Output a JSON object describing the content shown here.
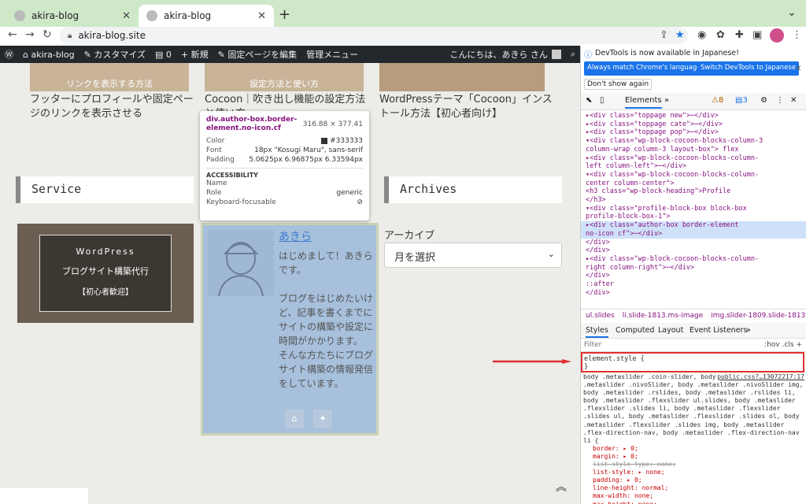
{
  "browser": {
    "tabs": [
      {
        "title": "akira-blog",
        "active": false
      },
      {
        "title": "akira-blog",
        "active": true
      }
    ],
    "new_tab": "+",
    "url": "akira-blog.site",
    "toolbar_icons": [
      "back-icon",
      "forward-icon",
      "reload-icon",
      "share-icon",
      "star-icon",
      "camera-icon",
      "extension-icon",
      "puzzle-icon",
      "sidebar-icon",
      "profile-icon",
      "menu-icon"
    ]
  },
  "adminbar": {
    "items": [
      "akira-blog",
      "カスタマイズ",
      "0",
      "新規",
      "固定ページを編集",
      "管理メニュー"
    ],
    "greeting": "こんにちは、あきら さん"
  },
  "page": {
    "thumbs": [
      {
        "caption": "リンクを表示する方法"
      },
      {
        "caption": "設定方法と使い方"
      },
      {
        "caption": ""
      }
    ],
    "posts": [
      "フッターにプロフィールや固定ページのリンクを表示させる",
      "Cocoon｜吹き出し機能の設定方法と使い方",
      "WordPressテーマ「Cocoon」インストール方法【初心者向け】"
    ],
    "widgets": {
      "service": "Service",
      "archives": "Archives"
    },
    "banner": {
      "line1": "WordPress",
      "line2": "ブログサイト構築代行",
      "line3": "【初心者歓迎】"
    },
    "profile": {
      "name": "あきら",
      "bio": "はじめまして！あきらです。\n\nブログをはじめたいけど、記事を書くまでにサイトの構築や設定に時間がかかります。\nそんな方たちにブログサイト構築の情報発信をしています。"
    },
    "archive": {
      "label": "アーカイブ",
      "select_value": "月を選択"
    }
  },
  "inspect_tooltip": {
    "selector": "div.author-box.border-element.no-icon.cf",
    "size": "316.88 × 377.41",
    "color_label": "Color",
    "color_value": "#333333",
    "font_label": "Font",
    "font_value": "18px \"Kosugi Maru\", sans-serif",
    "padding_label": "Padding",
    "padding_value": "5.0625px 6.96875px 6.33594px",
    "accessibility": "ACCESSIBILITY",
    "name_label": "Name",
    "role_label": "Role",
    "role_value": "generic",
    "focus_label": "Keyboard-focusable"
  },
  "devtools": {
    "banner_msg": "DevTools is now available in Japanese!",
    "btn_match": "Always match Chrome's language",
    "btn_switch": "Switch DevTools to Japanese",
    "dont_show": "Don't show again",
    "tabs": {
      "elements": "Elements",
      "more": "»",
      "warnings": "8",
      "messages": "3"
    },
    "dom_lines": [
      "▸<div class=\"toppage new\">⋯</div>",
      "▸<div class=\"toppage cate\">⋯</div>",
      "▸<div class=\"toppage pop\">⋯</div>",
      "▾<div class=\"wp-block-cocoon-blocks-column-3",
      "  column-wrap column-3 layout-box\"> flex",
      "  ▸<div class=\"wp-block-cocoon-blocks-column-",
      "   left column-left\">⋯</div>",
      "  ▾<div class=\"wp-block-cocoon-blocks-column-",
      "   center column-center\">",
      "     <h3 class=\"wp-block-heading\">Profile",
      "     </h3>",
      "   ▾<div class=\"profile-block-box block-box",
      "     profile-block-box-1\">",
      "     ▸<div class=\"author-box border-element",
      "       no-icon cf\">⋯</div>",
      "     </div>",
      "   </div>",
      "  ▸<div class=\"wp-block-cocoon-blocks-column-",
      "   right column-right\">⋯</div>",
      "  </div>",
      "  ::after",
      "</div>"
    ],
    "crumbs": [
      "ul.slides",
      "li.slide-1813.ms-image",
      "img.slider-1809.slide-1813"
    ],
    "style_tabs": [
      "Styles",
      "Computed",
      "Layout",
      "Event Listeners",
      "»"
    ],
    "filter": "Filter",
    "filter_tools": ":hov  .cls  +",
    "element_style": [
      "element.style {",
      "}"
    ],
    "rule_source": "public.css?…13072217:17",
    "rule_selector": "body .metaslider .coin-slider, body .metaslider .nivoSlider, body .metaslider .nivoSlider img, body .metaslider .rslides, body .metaslider .rslides li, body .metaslider .flexslider ul.slides, body .metaslider .flexslider .slides li, body .metaslider .flexslider .slides ul, body .metaslider .flexslider .slides ol, body .metaslider .flexslider .slides img, body .metaslider .flex-direction-nav, body .metaslider .flex-direction-nav li {",
    "rule_props": [
      {
        "text": "border: ▸ 0;",
        "struck": false
      },
      {
        "text": "margin: ▸ 0;",
        "struck": false
      },
      {
        "text": "list-style-type: none;",
        "struck": true
      },
      {
        "text": "list-style: ▸ none;",
        "struck": false
      },
      {
        "text": "padding: ▸ 0;",
        "struck": false
      },
      {
        "text": "line-height: normal;",
        "struck": false
      },
      {
        "text": "max-width: none;",
        "struck": false
      },
      {
        "text": "max-height: none;",
        "struck": false
      }
    ],
    "rule_close": "}"
  },
  "colors": {
    "admin_bar": "#23282d",
    "accent": "#1a73e8",
    "highlight_red": "#e03030",
    "profile_overlay": "#a7c0dc"
  }
}
